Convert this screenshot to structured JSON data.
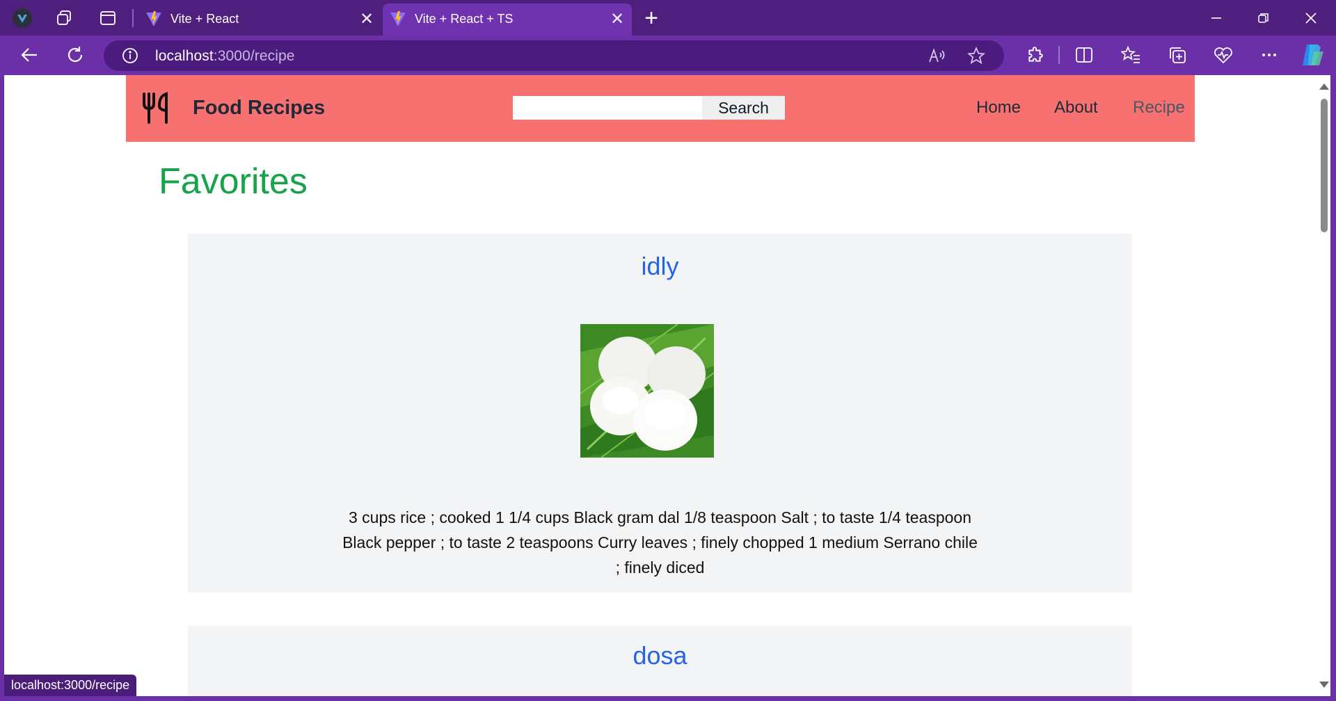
{
  "browser": {
    "tabs": [
      {
        "title": "Vite + React",
        "active": false
      },
      {
        "title": "Vite + React + TS",
        "active": true
      }
    ],
    "address": {
      "host": "localhost",
      "path": ":3000/recipe"
    },
    "status_url": "localhost:3000/recipe",
    "colors": {
      "frame": "#6b2fa8",
      "tabstrip": "#4f1f7d",
      "active_tab": "#6f33b0"
    }
  },
  "site": {
    "brand": "Food Recipes",
    "search": {
      "placeholder": "",
      "value": "",
      "button_label": "Search"
    },
    "nav": [
      {
        "label": "Home",
        "state": "normal"
      },
      {
        "label": "About",
        "state": "normal"
      },
      {
        "label": "Recipe",
        "state": "current"
      }
    ],
    "colors": {
      "header": "#f87171",
      "title": "#16a34a",
      "card_title": "#2563eb",
      "card_bg": "#f3f4f6"
    }
  },
  "page": {
    "title": "Favorites",
    "recipes": [
      {
        "name": "idly",
        "image": "idly-on-banana-leaf",
        "ingredients": "3 cups rice ; cooked 1 1/4 cups Black gram dal 1/8 teaspoon Salt ; to taste 1/4 teaspoon Black pepper ; to taste 2 teaspoons Curry leaves ; finely chopped 1 medium Serrano chile ; finely diced"
      },
      {
        "name": "dosa"
      }
    ]
  }
}
